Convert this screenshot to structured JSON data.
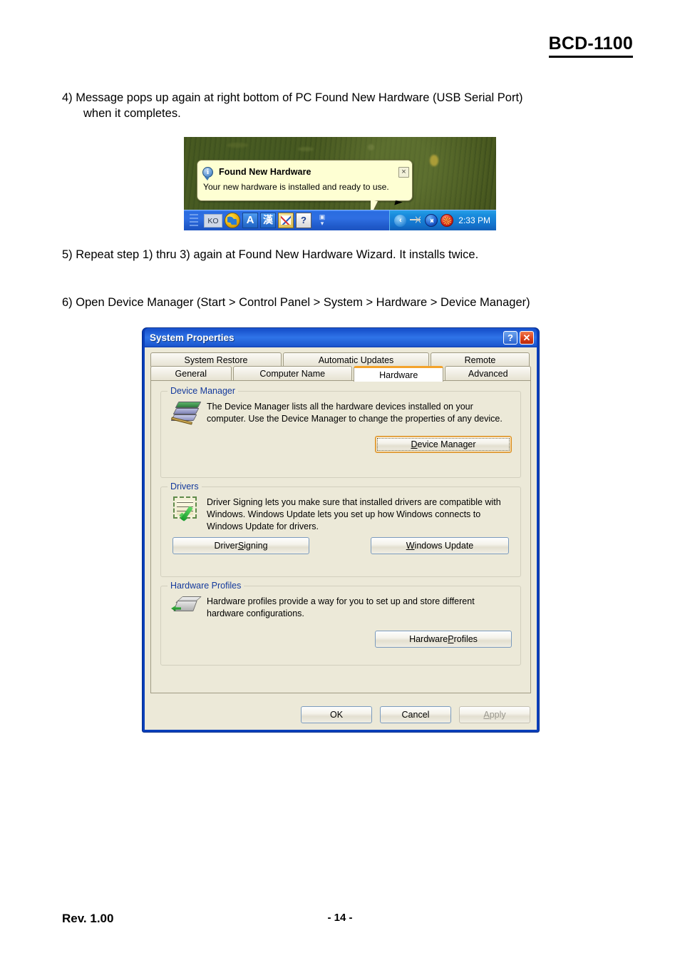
{
  "document": {
    "header_title": "BCD-1100",
    "footer_revision": "Rev. 1.00",
    "footer_page": "- 14 -"
  },
  "steps": {
    "step4_line1": "4) Message pops up again at right bottom of PC Found New Hardware (USB Serial Port)",
    "step4_line2": "when it completes.",
    "step5": "5) Repeat step 1) thru 3) again at Found New Hardware Wizard. It installs twice.",
    "step6": "6) Open Device Manager (Start > Control Panel > System > Hardware > Device Manager)"
  },
  "balloon_screenshot": {
    "notification": {
      "title": "Found New Hardware",
      "body": "Your new hardware is installed and ready to use.",
      "close_label": "×",
      "info_glyph": "i"
    },
    "taskbar": {
      "language_indicator": "KO",
      "icon_a": "A",
      "icon_han": "漢",
      "icon_help": "?",
      "arrows": "❐\n▾",
      "tray_chevron": "‹",
      "clock": "2:33 PM",
      "icon_names": [
        "globe-icon",
        "ime-a-icon",
        "ime-han-icon",
        "ime-tools-icon",
        "ime-help-icon",
        "ime-expand-icon",
        "usb-icon",
        "bluetooth-icon",
        "antivirus-icon"
      ]
    }
  },
  "system_properties": {
    "title": "System Properties",
    "help_button": "?",
    "close_button": "✕",
    "tabs_row1": [
      {
        "label": "System Restore",
        "active": false
      },
      {
        "label": "Automatic Updates",
        "active": false
      },
      {
        "label": "Remote",
        "active": false
      }
    ],
    "tabs_row2": [
      {
        "label": "General",
        "active": false
      },
      {
        "label": "Computer Name",
        "active": false
      },
      {
        "label": "Hardware",
        "active": true
      },
      {
        "label": "Advanced",
        "active": false
      }
    ],
    "groups": {
      "device_manager": {
        "legend": "Device Manager",
        "description": "The Device Manager lists all the hardware devices installed on your computer. Use the Device Manager to change the properties of any device.",
        "button": "Device Manager",
        "button_focused": true
      },
      "drivers": {
        "legend": "Drivers",
        "description": "Driver Signing lets you make sure that installed drivers are compatible with Windows. Windows Update lets you set up how Windows connects to Windows Update for drivers.",
        "button_driver_signing": "Driver Signing",
        "button_windows_update": "Windows Update"
      },
      "hardware_profiles": {
        "legend": "Hardware Profiles",
        "description": "Hardware profiles provide a way for you to set up and store different hardware configurations.",
        "button": "Hardware Profiles"
      }
    },
    "actions": {
      "ok": "OK",
      "cancel": "Cancel",
      "apply": "Apply",
      "apply_disabled": true
    }
  },
  "colors": {
    "title_bar_blue": "#1852cd",
    "dialog_face": "#ece9d8",
    "group_legend_blue": "#13399c",
    "active_tab_accent": "#f3a32b",
    "taskbar_blue": "#2f6fe2",
    "balloon_bg": "#feffd3"
  }
}
